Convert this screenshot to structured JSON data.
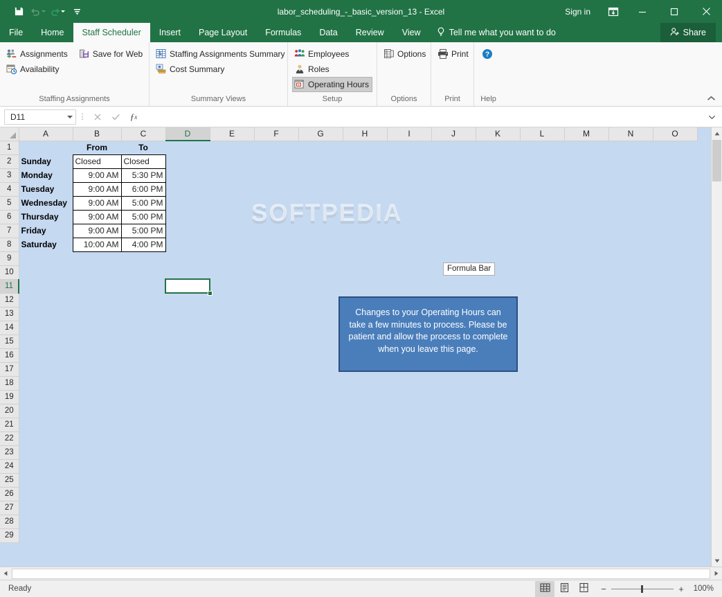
{
  "titlebar": {
    "document_title": "labor_scheduling_-_basic_version_13 - Excel",
    "signin_label": "Sign in",
    "qat": [
      {
        "name": "save",
        "icon": "save-icon"
      },
      {
        "name": "undo",
        "icon": "undo-icon"
      },
      {
        "name": "redo",
        "icon": "redo-icon"
      },
      {
        "name": "customize",
        "icon": "customize-quick-access-icon"
      }
    ],
    "window_controls": [
      "ribbon-display-options",
      "minimize",
      "maximize",
      "close"
    ]
  },
  "tabs": [
    {
      "label": "File",
      "active": false
    },
    {
      "label": "Home",
      "active": false
    },
    {
      "label": "Staff Scheduler",
      "active": true
    },
    {
      "label": "Insert",
      "active": false
    },
    {
      "label": "Page Layout",
      "active": false
    },
    {
      "label": "Formulas",
      "active": false
    },
    {
      "label": "Data",
      "active": false
    },
    {
      "label": "Review",
      "active": false
    },
    {
      "label": "View",
      "active": false
    }
  ],
  "tellme": {
    "label": "Tell me what you want to do"
  },
  "share": {
    "label": "Share"
  },
  "ribbon": {
    "groups": [
      {
        "label": "Staffing Assignments",
        "columns": [
          {
            "items": [
              {
                "label": "Assignments",
                "icon": "people-assignments-icon",
                "selected": false
              },
              {
                "label": "Availability",
                "icon": "calendar-clock-icon",
                "selected": false
              }
            ]
          },
          {
            "items": [
              {
                "label": "Save for Web",
                "icon": "save-web-icon",
                "selected": false
              }
            ]
          }
        ]
      },
      {
        "label": "Summary Views",
        "columns": [
          {
            "items": [
              {
                "label": "Staffing Assignments Summary",
                "icon": "sigma-table-icon",
                "selected": false
              },
              {
                "label": "Cost Summary",
                "icon": "money-summary-icon",
                "selected": false
              }
            ]
          }
        ]
      },
      {
        "label": "Setup",
        "columns": [
          {
            "items": [
              {
                "label": "Employees",
                "icon": "employees-icon",
                "selected": false
              },
              {
                "label": "Roles",
                "icon": "role-person-icon",
                "selected": false
              },
              {
                "label": "Operating Hours",
                "icon": "operating-hours-icon",
                "selected": true
              }
            ]
          }
        ]
      },
      {
        "label": "Options",
        "columns": [
          {
            "items": [
              {
                "label": "Options",
                "icon": "options-list-icon",
                "selected": false
              }
            ]
          }
        ]
      },
      {
        "label": "Print",
        "columns": [
          {
            "items": [
              {
                "label": "Print",
                "icon": "printer-icon",
                "selected": false
              }
            ]
          }
        ]
      },
      {
        "label": "Help",
        "columns": [
          {
            "items": [
              {
                "label": "",
                "icon": "help-question-icon",
                "selected": false
              }
            ]
          }
        ]
      }
    ]
  },
  "formula_bar": {
    "name_box_value": "D11",
    "formula_value": "",
    "cancel_icon": "cancel-x-icon",
    "enter_icon": "enter-check-icon",
    "function_icon": "insert-function-icon",
    "expand_icon": "expand-formula-bar-icon"
  },
  "grid": {
    "columns": [
      "A",
      "B",
      "C",
      "D",
      "E",
      "F",
      "G",
      "H",
      "I",
      "J",
      "K",
      "L",
      "M",
      "N",
      "O"
    ],
    "selected_column": "D",
    "selected_row": 11,
    "rows": [
      1,
      2,
      3,
      4,
      5,
      6,
      7,
      8,
      9,
      10,
      11,
      12,
      13,
      14,
      15,
      16,
      17,
      18,
      19,
      20,
      21,
      22,
      23,
      24,
      25,
      26,
      27,
      28,
      29
    ],
    "table": {
      "headers": {
        "from": "From",
        "to": "To"
      },
      "data": [
        {
          "day": "Sunday",
          "from": "Closed",
          "to": "Closed",
          "closed": true
        },
        {
          "day": "Monday",
          "from": "9:00 AM",
          "to": "5:30 PM",
          "closed": false
        },
        {
          "day": "Tuesday",
          "from": "9:00 AM",
          "to": "6:00 PM",
          "closed": false
        },
        {
          "day": "Wednesday",
          "from": "9:00 AM",
          "to": "5:00 PM",
          "closed": false
        },
        {
          "day": "Thursday",
          "from": "9:00 AM",
          "to": "5:00 PM",
          "closed": false
        },
        {
          "day": "Friday",
          "from": "9:00 AM",
          "to": "5:00 PM",
          "closed": false
        },
        {
          "day": "Saturday",
          "from": "10:00 AM",
          "to": "4:00 PM",
          "closed": false
        }
      ]
    }
  },
  "message_box": {
    "text": "Changes to your  Operating Hours can take a few minutes to process. Please be patient and allow the process to complete when you leave this page.",
    "background": "#4a7ebb",
    "border": "#2b4f7d"
  },
  "tooltip": {
    "text": "Formula Bar"
  },
  "watermark": {
    "text": "SOFTPEDIA"
  },
  "status_bar": {
    "status_text": "Ready",
    "views": [
      {
        "name": "normal-view",
        "icon": "grid-view-icon",
        "active": true
      },
      {
        "name": "page-layout-view",
        "icon": "page-layout-icon",
        "active": false
      },
      {
        "name": "page-break-preview",
        "icon": "page-break-icon",
        "active": false
      }
    ],
    "zoom_out_label": "−",
    "zoom_in_label": "+",
    "zoom_level": "100%"
  },
  "theme": {
    "excel_green": "#217346",
    "share_green": "#1b5e3a",
    "grid_blue": "#c5d9f1",
    "selection_green": "#217346"
  }
}
